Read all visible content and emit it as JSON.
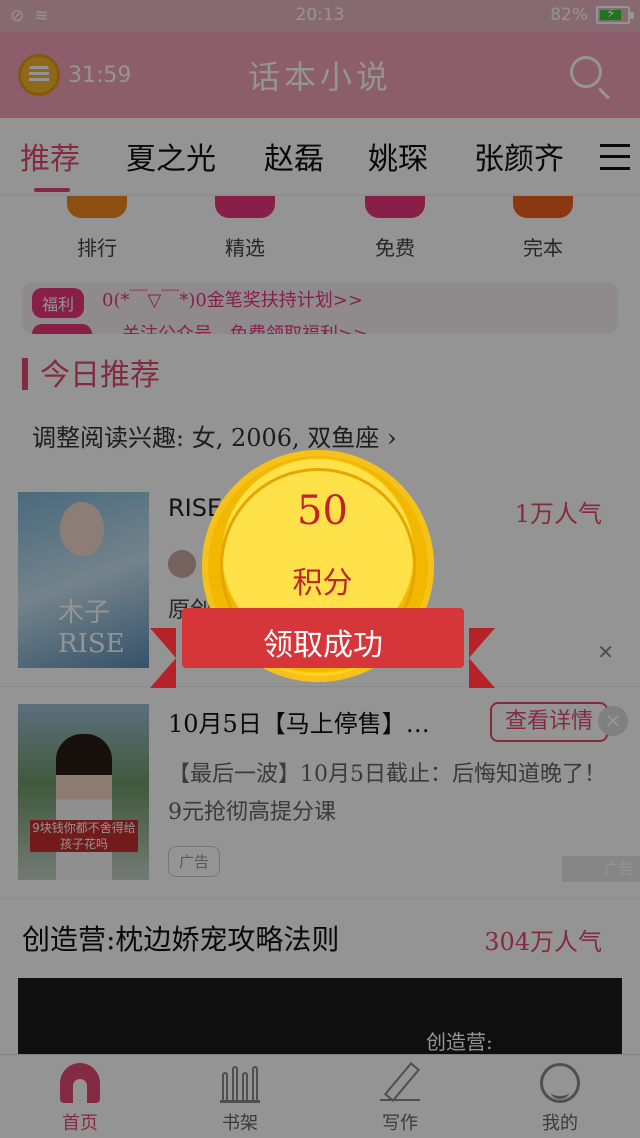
{
  "status_bar": {
    "time": "20:13",
    "battery": "82%",
    "battery_level": 0.82
  },
  "header": {
    "timer": "31:59",
    "title": "话本小说"
  },
  "tabs": [
    "推荐",
    "夏之光",
    "赵磊",
    "姚琛",
    "张颜齐"
  ],
  "quick_entries": [
    {
      "label": "排行",
      "color": "#f08a1e"
    },
    {
      "label": "精选",
      "color": "#e8367a"
    },
    {
      "label": "免费",
      "color": "#e8367a"
    },
    {
      "label": "完本",
      "color": "#f0601e"
    }
  ],
  "notice": {
    "tag": "福利",
    "text": "0(*￣▽￣*)0金笔奖扶持计划>>",
    "text2": "关注公众号，免费领取福利>>"
  },
  "section": {
    "title": "今日推荐",
    "preference": "调整阅读兴趣: 女, 2006, 双鱼座"
  },
  "book1": {
    "title": "RISE",
    "popularity": "1万人气",
    "description": "原创有甜有虐这…",
    "cover_text": "木子RISE"
  },
  "ad": {
    "title": "10月5日【马上停售】…",
    "button": "查看详情",
    "description": "【最后一波】10月5日截止：后悔知道晚了！9元抢彻高提分课",
    "label": "广告",
    "corner": "广告",
    "cover_caption": "9块钱你都不舍得给孩子花吗"
  },
  "book2": {
    "title": "创造营:枕边娇宠攻略法则",
    "popularity": "304万人气",
    "cover_text": "创造营:"
  },
  "reward": {
    "points": "50",
    "unit": "积分",
    "message": "领取成功"
  },
  "bottom_nav": [
    "首页",
    "书架",
    "写作",
    "我的"
  ]
}
